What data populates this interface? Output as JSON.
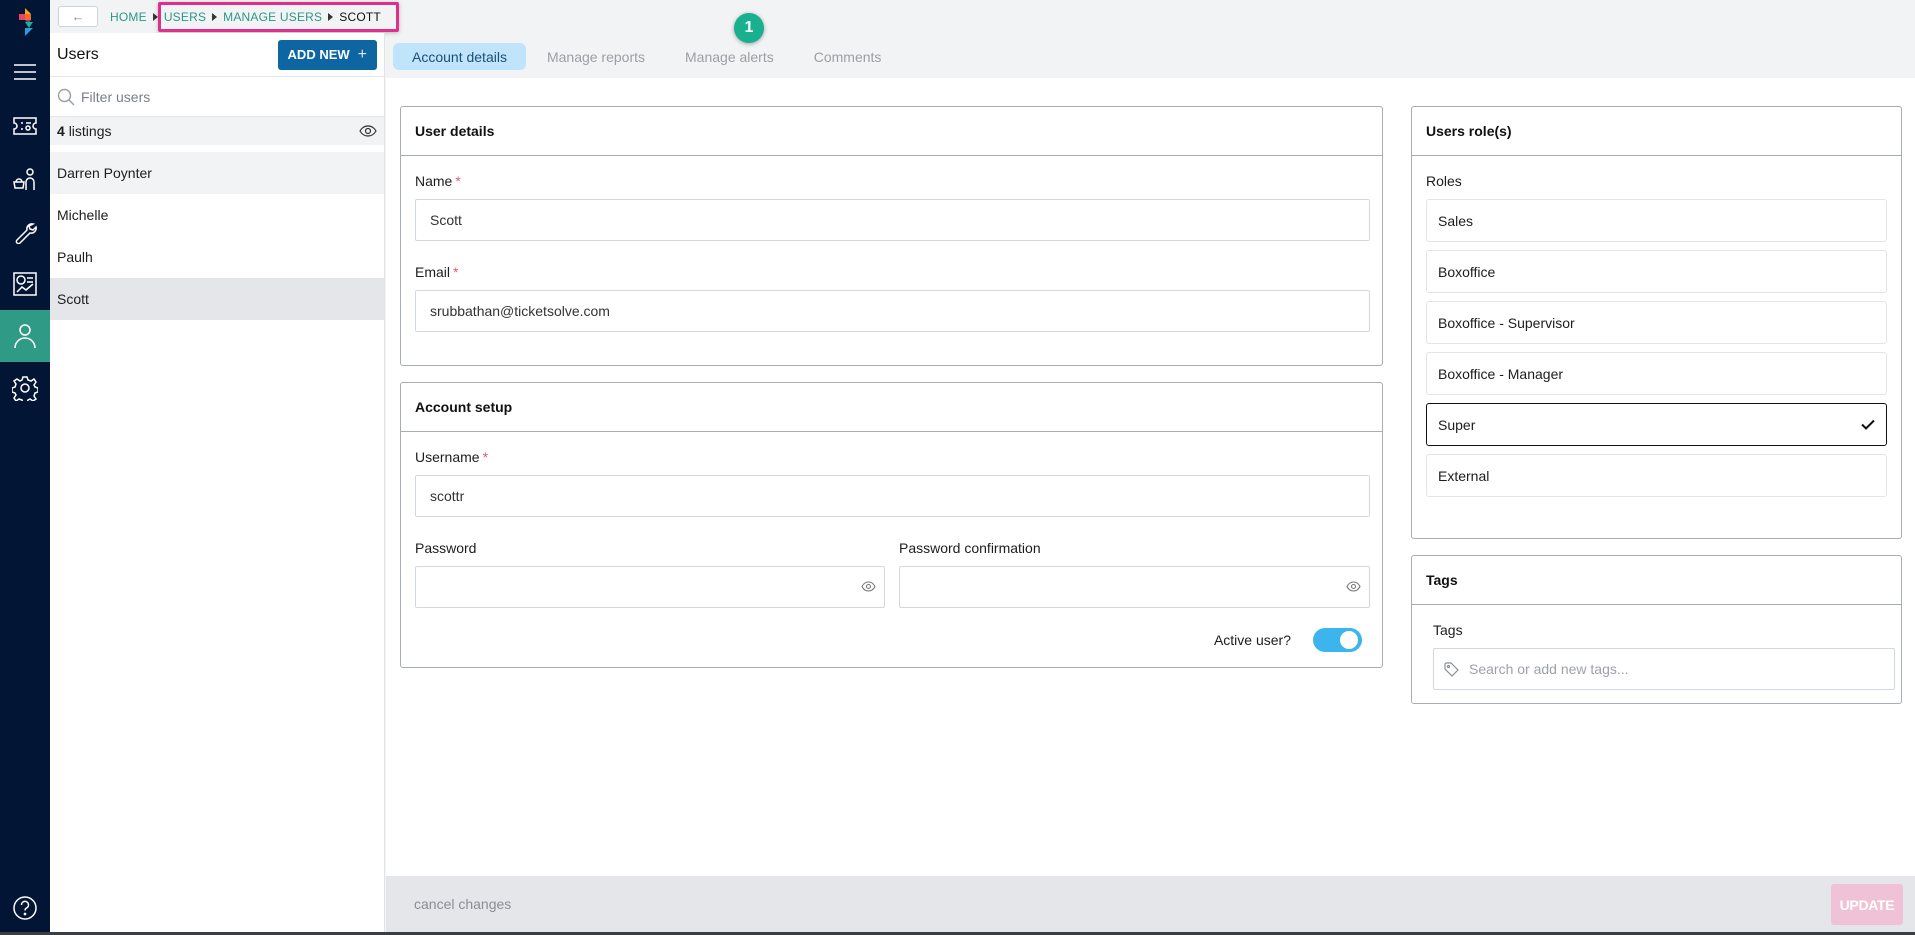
{
  "nav": {
    "items": [
      {
        "name": "menu",
        "icon": "hamburger-menu-icon"
      },
      {
        "name": "tickets",
        "icon": "ticket-icon"
      },
      {
        "name": "customers",
        "icon": "customer-basket-icon"
      },
      {
        "name": "tools",
        "icon": "wrench-icon"
      },
      {
        "name": "reports",
        "icon": "report-chart-icon"
      },
      {
        "name": "users",
        "icon": "user-icon",
        "active": true
      },
      {
        "name": "settings",
        "icon": "gear-icon"
      }
    ],
    "help_icon": "help-circle-icon",
    "active_color": "#2f9b87"
  },
  "topbar": {
    "back_icon": "arrow-left-icon",
    "back_glyph": "←",
    "breadcrumb": [
      {
        "label": "HOME"
      },
      {
        "label": "USERS"
      },
      {
        "label": "MANAGE USERS"
      },
      {
        "label": "SCOTT",
        "current": true
      }
    ]
  },
  "users_panel": {
    "title": "Users",
    "add_new_label": "ADD NEW",
    "add_new_icon": "+",
    "filter_placeholder": "Filter users",
    "listings_count": "4",
    "listings_label": "listings",
    "users": [
      {
        "name": "Darren Poynter"
      },
      {
        "name": "Michelle"
      },
      {
        "name": "Paulh"
      },
      {
        "name": "Scott",
        "selected": true
      }
    ]
  },
  "tabs": [
    {
      "label": "Account details",
      "active": true
    },
    {
      "label": "Manage reports"
    },
    {
      "label": "Manage alerts"
    },
    {
      "label": "Comments"
    }
  ],
  "step_badge": "1",
  "user_details": {
    "title": "User details",
    "name_label": "Name",
    "name_value": "Scott",
    "email_label": "Email",
    "email_value": "srubbathan@ticketsolve.com",
    "required_marker": "*"
  },
  "account_setup": {
    "title": "Account setup",
    "username_label": "Username",
    "username_value": "scottr",
    "password_label": "Password",
    "password_value": "",
    "password_confirm_label": "Password confirmation",
    "password_confirm_value": "",
    "active_label": "Active user?",
    "active": true
  },
  "roles": {
    "title": "Users role(s)",
    "label": "Roles",
    "items": [
      {
        "label": "Sales",
        "selected": false
      },
      {
        "label": "Boxoffice",
        "selected": false
      },
      {
        "label": "Boxoffice - Supervisor",
        "selected": false
      },
      {
        "label": "Boxoffice - Manager",
        "selected": false
      },
      {
        "label": "Super",
        "selected": true
      },
      {
        "label": "External",
        "selected": false
      }
    ],
    "check_glyph": "✔"
  },
  "tags": {
    "title": "Tags",
    "label": "Tags",
    "placeholder": "Search or add new tags..."
  },
  "footer": {
    "cancel_label": "cancel changes",
    "update_label": "UPDATE",
    "update_color": "#f0c2d7"
  },
  "colors": {
    "rail": "#021535",
    "accent": "#2b9785",
    "primary_button": "#0d66a1",
    "toggle_on": "#3cb5ef",
    "highlight": "#de2f8a",
    "badge": "#18b08f"
  }
}
